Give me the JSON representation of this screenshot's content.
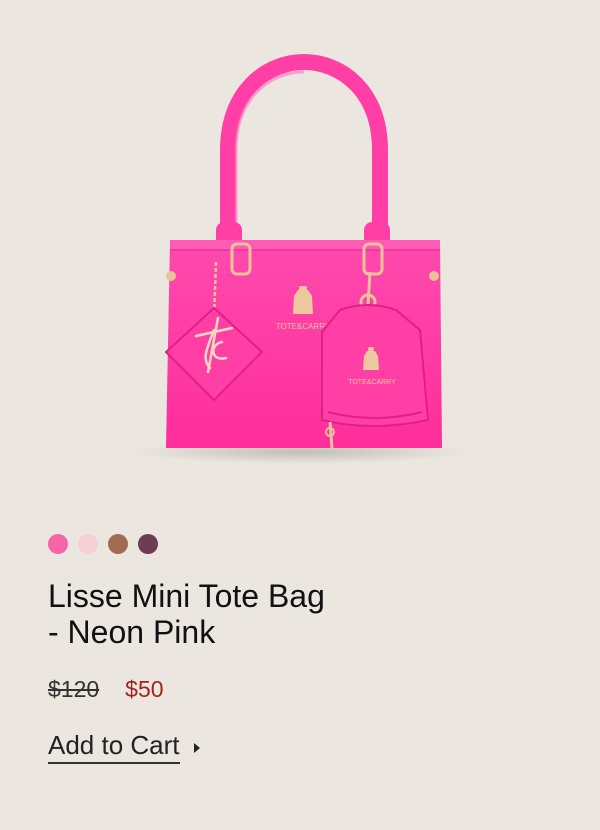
{
  "product": {
    "name_line1": "Lisse Mini Tote Bag",
    "name_line2": "- Neon Pink",
    "old_price": "$120",
    "sale_price": "$50",
    "brand_label_bag": "TOTE&CARRY",
    "brand_label_pouch": "TOTE&CARRY",
    "image_icon": "handbag-image",
    "swatches": [
      {
        "name": "neon-pink",
        "color": "#f765a8"
      },
      {
        "name": "light-pink",
        "color": "#f6cfd8"
      },
      {
        "name": "tan",
        "color": "#a26b52"
      },
      {
        "name": "plum",
        "color": "#6d3b52"
      }
    ]
  },
  "actions": {
    "add_to_cart_label": "Add to Cart",
    "add_to_cart_icon": "caret-right-icon"
  },
  "colors": {
    "background": "#ebe7e0",
    "bag_pink": "#ff3fa6",
    "sale_red": "#a5211c",
    "hardware_gold": "#e8c39a"
  }
}
